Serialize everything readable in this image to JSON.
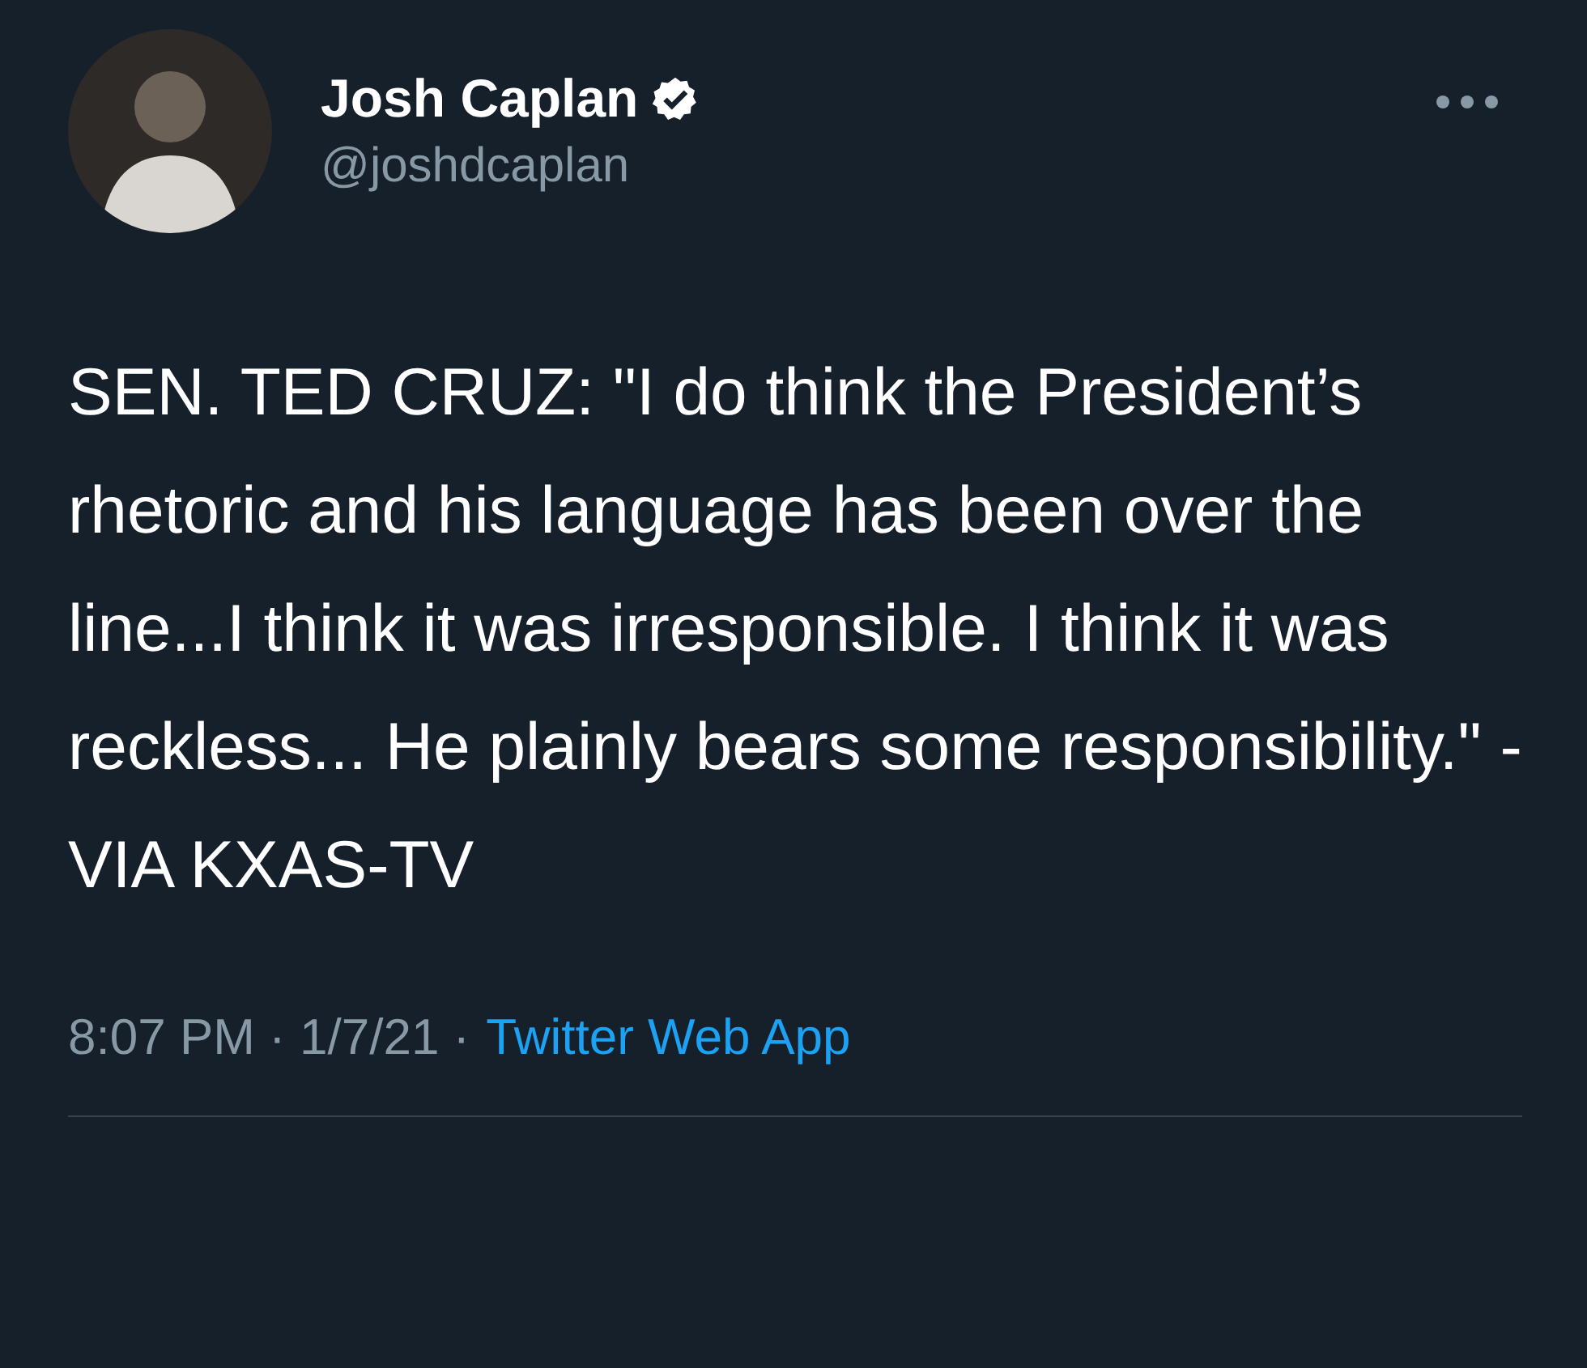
{
  "tweet": {
    "author": {
      "name": "Josh Caplan",
      "handle": "@joshdcaplan",
      "verified": true
    },
    "text": "SEN. TED CRUZ: \"I do think the President’s rhetoric and his language has been over the line...I think it was irresponsible. I think it was reckless... He plainly bears some responsibility.\" -  VIA KXAS-TV",
    "time": "8:07 PM",
    "separator": "·",
    "date": "1/7/21",
    "source": "Twitter Web App"
  }
}
